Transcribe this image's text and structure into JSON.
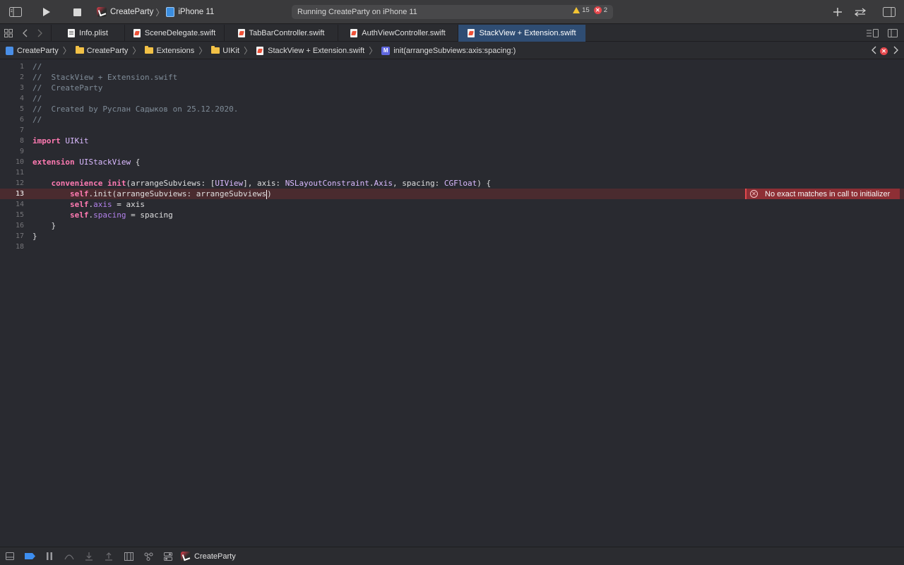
{
  "toolbar": {
    "scheme_name": "CreateParty",
    "device_name": "iPhone 11",
    "activity_text": "Running CreateParty on iPhone 11",
    "warning_count": "15",
    "error_count": "2",
    "icons": [
      "sidebar-toggle-icon",
      "run-icon",
      "stop-icon",
      "add-icon",
      "swap-icon",
      "inspector-toggle-icon"
    ]
  },
  "tabs": [
    {
      "label": "Info.plist",
      "icon": "plist-file-icon"
    },
    {
      "label": "SceneDelegate.swift",
      "icon": "swift-file-icon"
    },
    {
      "label": "TabBarController.swift",
      "icon": "swift-file-icon"
    },
    {
      "label": "AuthViewController.swift",
      "icon": "swift-file-icon"
    },
    {
      "label": "StackView + Extension.swift",
      "icon": "swift-file-icon",
      "active": true
    }
  ],
  "jumpbar": {
    "crumbs": [
      {
        "label": "CreateParty",
        "icon": "project-icon"
      },
      {
        "label": "CreateParty",
        "icon": "folder-icon"
      },
      {
        "label": "Extensions",
        "icon": "folder-icon"
      },
      {
        "label": "UIKit",
        "icon": "folder-icon"
      },
      {
        "label": "StackView + Extension.swift",
        "icon": "swift-file-icon"
      },
      {
        "label": "init(arrangeSubviews:axis:spacing:)",
        "icon": "method-icon",
        "badge": "M"
      }
    ]
  },
  "editor": {
    "current_line": 13,
    "lines": [
      {
        "n": "1",
        "text": "//"
      },
      {
        "n": "2",
        "text": "//  StackView + Extension.swift"
      },
      {
        "n": "3",
        "text": "//  CreateParty"
      },
      {
        "n": "4",
        "text": "//"
      },
      {
        "n": "5",
        "text": "//  Created by Руслан Садыков on 25.12.2020."
      },
      {
        "n": "6",
        "text": "//"
      },
      {
        "n": "7",
        "text": ""
      },
      {
        "n": "8",
        "text": "import UIKit"
      },
      {
        "n": "9",
        "text": ""
      },
      {
        "n": "10",
        "text": "extension UIStackView {"
      },
      {
        "n": "11",
        "text": ""
      },
      {
        "n": "12",
        "text": "    convenience init(arrangeSubviews: [UIView], axis: NSLayoutConstraint.Axis, spacing: CGFloat) {"
      },
      {
        "n": "13",
        "text": "        self.init(arrangeSubviews: arrangeSubviews)"
      },
      {
        "n": "14",
        "text": "        self.axis = axis"
      },
      {
        "n": "15",
        "text": "        self.spacing = spacing"
      },
      {
        "n": "16",
        "text": "    }"
      },
      {
        "n": "17",
        "text": "}"
      },
      {
        "n": "18",
        "text": ""
      }
    ],
    "error_message": "No exact matches in call to initializer"
  },
  "debugbar": {
    "target_label": "CreateParty"
  },
  "colors": {
    "editor_bg": "#292a30",
    "keyword": "#ff7ab2",
    "comment": "#7f8c98",
    "type": "#dabaff",
    "error_line": "#4a2b2f",
    "error_banner": "#8e2f35",
    "active_tab": "#2f4d73"
  }
}
